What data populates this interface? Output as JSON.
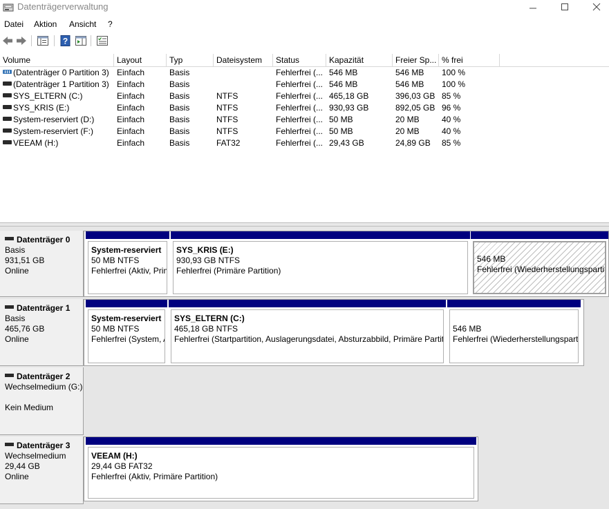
{
  "window": {
    "title": "Datenträgerverwaltung"
  },
  "menu": [
    "Datei",
    "Aktion",
    "Ansicht",
    "?"
  ],
  "list": {
    "columns": [
      "Volume",
      "Layout",
      "Typ",
      "Dateisystem",
      "Status",
      "Kapazität",
      "Freier Sp...",
      "% frei"
    ],
    "rows": [
      {
        "volume": "(Datenträger 0 Partition 3)",
        "layout": "Einfach",
        "typ": "Basis",
        "fs": "",
        "status": "Fehlerfrei (...",
        "kap": "546 MB",
        "frei": "546 MB",
        "pct": "100 %",
        "icon": "striped"
      },
      {
        "volume": "(Datenträger 1 Partition 3)",
        "layout": "Einfach",
        "typ": "Basis",
        "fs": "",
        "status": "Fehlerfrei (...",
        "kap": "546 MB",
        "frei": "546 MB",
        "pct": "100 %",
        "icon": "plain"
      },
      {
        "volume": "SYS_ELTERN (C:)",
        "layout": "Einfach",
        "typ": "Basis",
        "fs": "NTFS",
        "status": "Fehlerfrei (...",
        "kap": "465,18 GB",
        "frei": "396,03 GB",
        "pct": "85 %",
        "icon": "plain"
      },
      {
        "volume": "SYS_KRIS (E:)",
        "layout": "Einfach",
        "typ": "Basis",
        "fs": "NTFS",
        "status": "Fehlerfrei (...",
        "kap": "930,93 GB",
        "frei": "892,05 GB",
        "pct": "96 %",
        "icon": "plain"
      },
      {
        "volume": "System-reserviert (D:)",
        "layout": "Einfach",
        "typ": "Basis",
        "fs": "NTFS",
        "status": "Fehlerfrei (...",
        "kap": "50 MB",
        "frei": "20 MB",
        "pct": "40 %",
        "icon": "plain"
      },
      {
        "volume": "System-reserviert (F:)",
        "layout": "Einfach",
        "typ": "Basis",
        "fs": "NTFS",
        "status": "Fehlerfrei (...",
        "kap": "50 MB",
        "frei": "20 MB",
        "pct": "40 %",
        "icon": "plain"
      },
      {
        "volume": "VEEAM (H:)",
        "layout": "Einfach",
        "typ": "Basis",
        "fs": "FAT32",
        "status": "Fehlerfrei (...",
        "kap": "29,43 GB",
        "frei": "24,89 GB",
        "pct": "85 %",
        "icon": "plain"
      }
    ]
  },
  "disks": [
    {
      "name": "Datenträger 0",
      "type": "Basis",
      "size": "931,51 GB",
      "blank": "",
      "state": "Online",
      "partitions": [
        {
          "name": "System-reserviert",
          "size": "50 MB NTFS",
          "status": "Fehlerfrei (Aktiv, Primäre Partition)"
        },
        {
          "name": "SYS_KRIS  (E:)",
          "size": "930,93 GB NTFS",
          "status": "Fehlerfrei (Primäre Partition)"
        },
        {
          "name": "",
          "size": "546 MB",
          "status": "Fehlerfrei (Wiederherstellungspartition)"
        }
      ]
    },
    {
      "name": "Datenträger 1",
      "type": "Basis",
      "size": "465,76 GB",
      "blank": "",
      "state": "Online",
      "partitions": [
        {
          "name": "System-reserviert",
          "size": "50 MB NTFS",
          "status": "Fehlerfrei (System, Aktiv, Primäre Partition)"
        },
        {
          "name": "SYS_ELTERN  (C:)",
          "size": "465,18 GB NTFS",
          "status": "Fehlerfrei (Startpartition, Auslagerungsdatei, Absturzabbild, Primäre Partition)"
        },
        {
          "name": "",
          "size": "546 MB",
          "status": "Fehlerfrei (Wiederherstellungspartition)"
        }
      ]
    },
    {
      "name": "Datenträger 2",
      "type": "Wechselmedium (G:)",
      "size": "",
      "blank": "",
      "state": "Kein Medium",
      "partitions": []
    },
    {
      "name": "Datenträger 3",
      "type": "Wechselmedium",
      "size": "29,44 GB",
      "blank": "",
      "state": "Online",
      "partitions": [
        {
          "name": "VEEAM  (H:)",
          "size": "29,44 GB FAT32",
          "status": "Fehlerfrei (Aktiv, Primäre Partition)"
        }
      ]
    }
  ]
}
